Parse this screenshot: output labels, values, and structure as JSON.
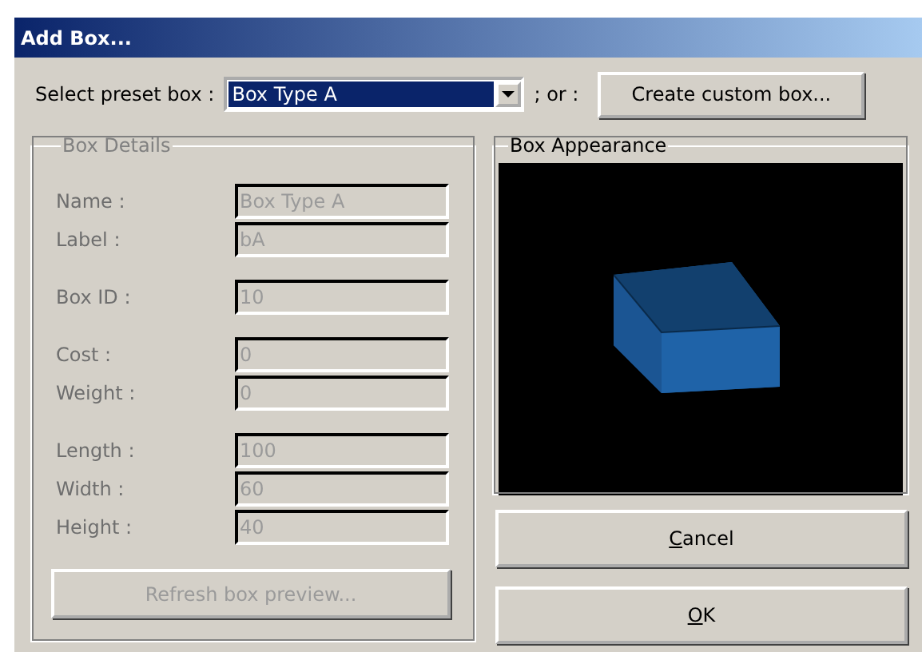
{
  "window": {
    "title": "Add Box..."
  },
  "preset": {
    "label": "Select preset box :",
    "value": "Box Type A",
    "separator": "; or :",
    "custom_button": "Create custom box..."
  },
  "details": {
    "title": "Box Details",
    "disabled": true,
    "groups": [
      [
        {
          "label": "Name :",
          "value": "Box Type A"
        },
        {
          "label": "Label :",
          "value": "bA"
        }
      ],
      [
        {
          "label": "Box ID :",
          "value": "10"
        }
      ],
      [
        {
          "label": "Cost :",
          "value": "0"
        },
        {
          "label": "Weight :",
          "value": "0"
        }
      ],
      [
        {
          "label": "Length :",
          "value": "100"
        },
        {
          "label": "Width :",
          "value": "60"
        },
        {
          "label": "Height :",
          "value": "40"
        }
      ]
    ],
    "refresh_button": {
      "label": "Refresh box preview...",
      "disabled": true
    }
  },
  "appearance": {
    "title": "Box Appearance"
  },
  "buttons": [
    {
      "label": "Cancel",
      "underline_first": true
    },
    {
      "label": "OK",
      "underline_first": true
    }
  ]
}
